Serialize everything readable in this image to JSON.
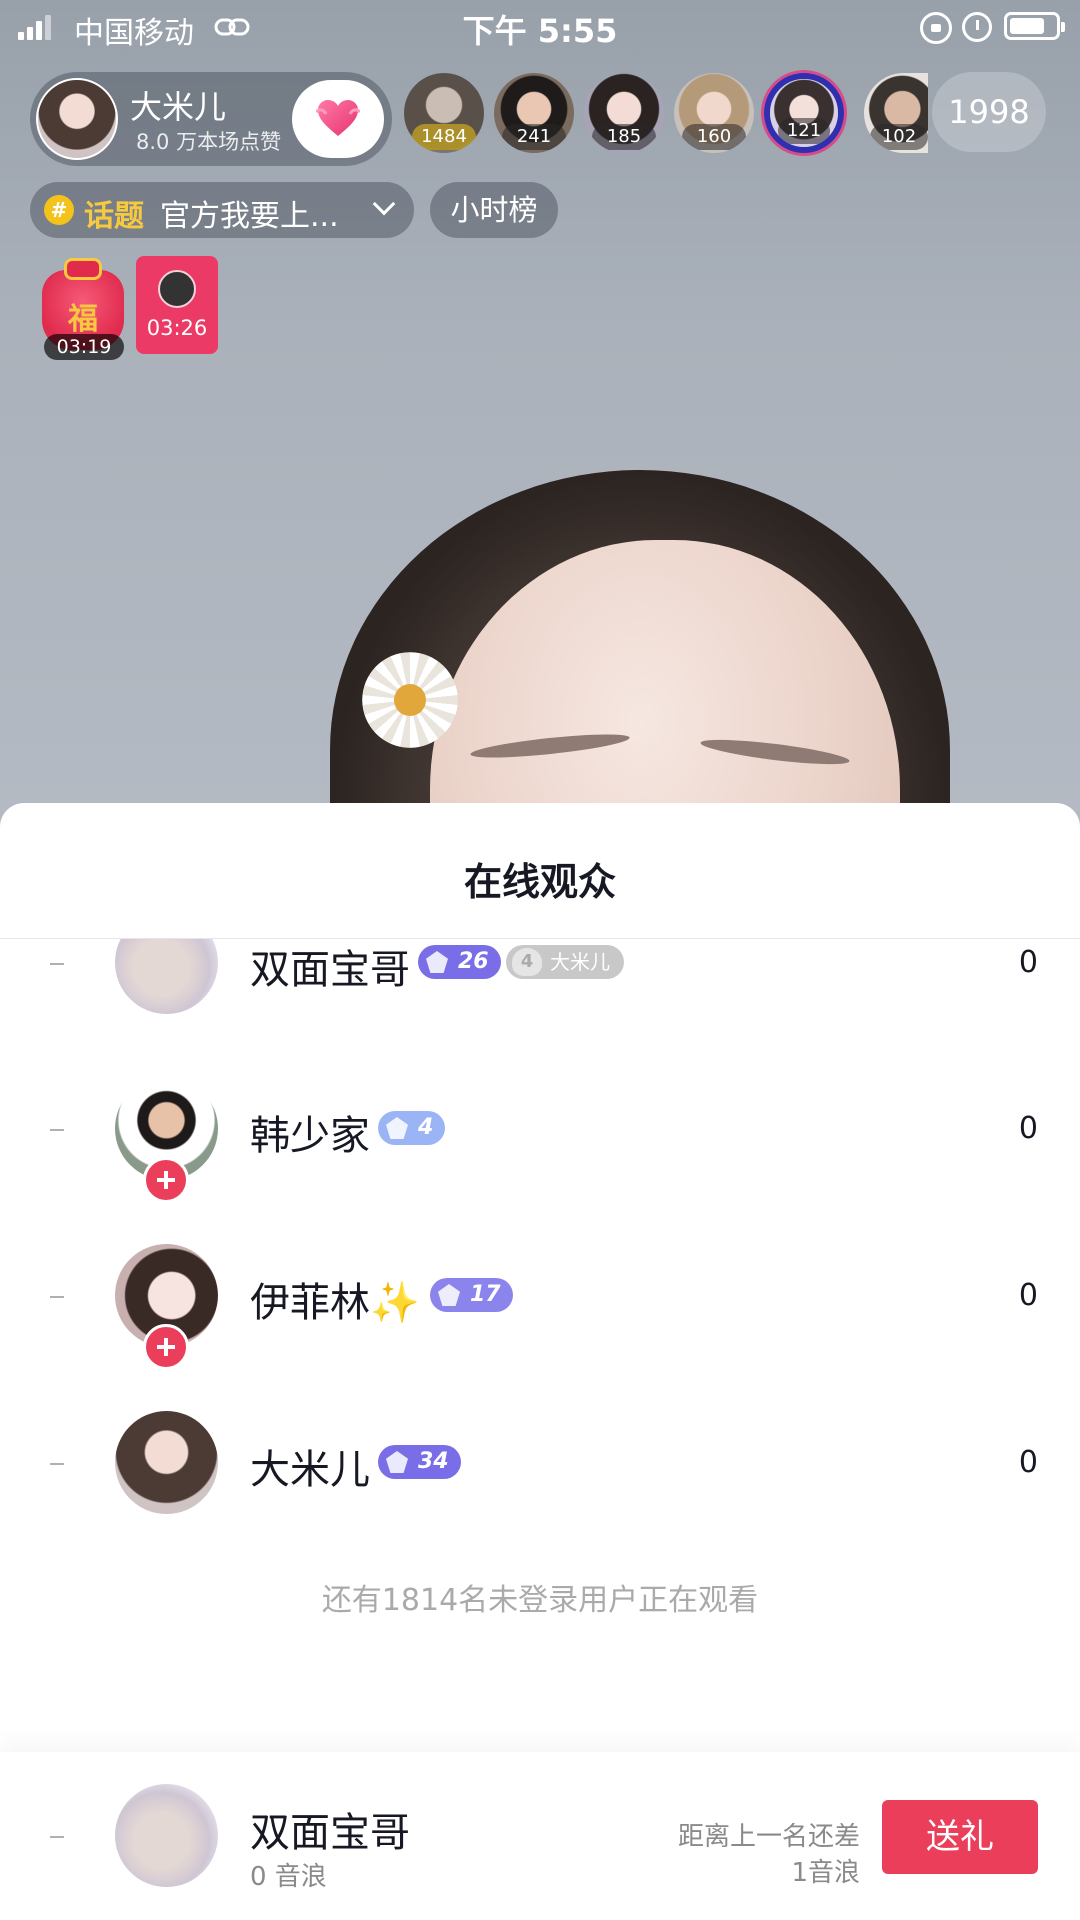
{
  "status_bar": {
    "carrier": "中国移动",
    "time": "下午 5:55"
  },
  "host": {
    "name": "大米儿",
    "likes": "8.0 万本场点赞"
  },
  "top_viewers": [
    {
      "count": "1484"
    },
    {
      "count": "241"
    },
    {
      "count": "185"
    },
    {
      "count": "160"
    },
    {
      "count": "121"
    },
    {
      "count": "102"
    }
  ],
  "viewer_total": "1998",
  "topic": {
    "tag": "话题",
    "text": "官方我要上...",
    "rank_label": "小时榜"
  },
  "gifts": {
    "fu_char": "福",
    "fu_timer": "03:19",
    "envelope_timer": "03:26"
  },
  "sheet": {
    "title": "在线观众",
    "rows": [
      {
        "name": "双面宝哥",
        "level": "26",
        "fan_level": "4",
        "fan_name": "大米儿",
        "score": "0",
        "follow": false
      },
      {
        "name": "韩少家",
        "level": "4",
        "score": "0",
        "follow": true
      },
      {
        "name": "伊菲林✨",
        "level": "17",
        "score": "0",
        "follow": true
      },
      {
        "name": "大米儿",
        "level": "34",
        "score": "0",
        "follow": false
      }
    ],
    "offline_note": "还有1814名未登录用户正在观看"
  },
  "self": {
    "name": "双面宝哥",
    "score": "0 音浪",
    "gap_line1": "距离上一名还差",
    "gap_line2": "1音浪",
    "gift_button": "送礼"
  },
  "colors": {
    "accent": "#ea3e5a",
    "level_purple": "#7a6ee8",
    "level_blue": "#9bb4f5",
    "topic_yellow": "#f6c940"
  }
}
